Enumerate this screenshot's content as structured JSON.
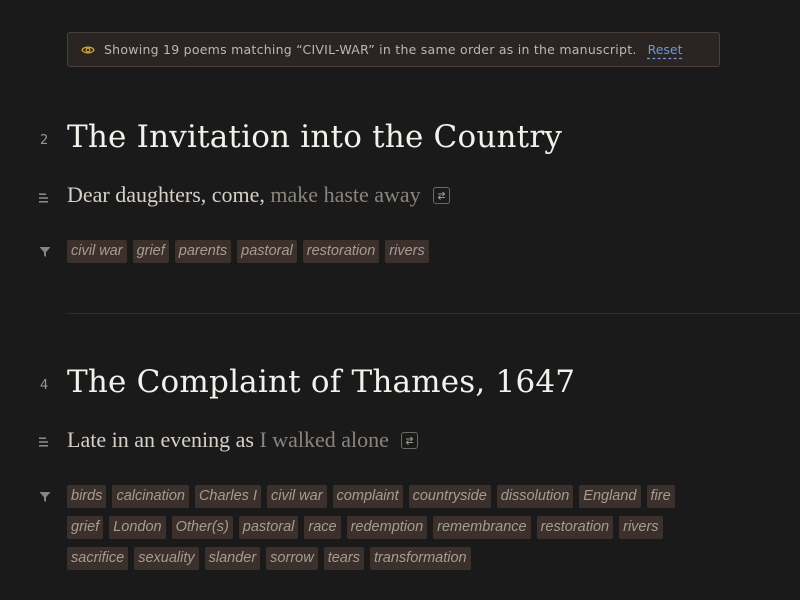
{
  "banner": {
    "icon": "eye-icon",
    "message": "Showing 19 poems matching “CIVIL-WAR” in the same order as in the manuscript.",
    "reset_label": "Reset"
  },
  "poems": [
    {
      "number": "2",
      "title": "The Invitation into the Country",
      "first_line_lead": "Dear daughters, come,",
      "first_line_fade": "make haste away",
      "tags": [
        "civil war",
        "grief",
        "parents",
        "pastoral",
        "restoration",
        "rivers"
      ]
    },
    {
      "number": "4",
      "title": "The Complaint of Thames, 1647",
      "first_line_lead": "Late in an evening as",
      "first_line_fade": "I walked alone",
      "tags": [
        "birds",
        "calcination",
        "Charles I",
        "civil war",
        "complaint",
        "countryside",
        "dissolution",
        "England",
        "fire",
        "grief",
        "London",
        "Other(s)",
        "pastoral",
        "race",
        "redemption",
        "remembrance",
        "restoration",
        "rivers",
        "sacrifice",
        "sexuality",
        "slander",
        "sorrow",
        "tears",
        "transformation"
      ]
    }
  ],
  "colors": {
    "background": "#1b1a1a",
    "banner_bg": "#2a2523",
    "tag_bg": "#3c302c",
    "link": "#6c97d8"
  }
}
